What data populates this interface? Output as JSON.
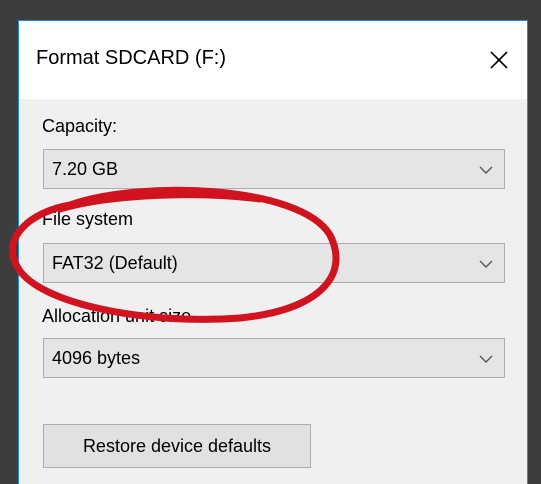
{
  "window": {
    "title": "Format SDCARD (F:)",
    "close_icon": "close-icon"
  },
  "capacity": {
    "label": "Capacity:",
    "value": "7.20 GB"
  },
  "file_system": {
    "label": "File system",
    "value": "FAT32 (Default)"
  },
  "allocation": {
    "label": "Allocation unit size",
    "value": "4096 bytes"
  },
  "buttons": {
    "restore_label": "Restore device defaults"
  },
  "colors": {
    "annotation_circle": "#d0131f",
    "window_border": "#1e8fd6",
    "dialog_background": "#f0f0f0"
  }
}
